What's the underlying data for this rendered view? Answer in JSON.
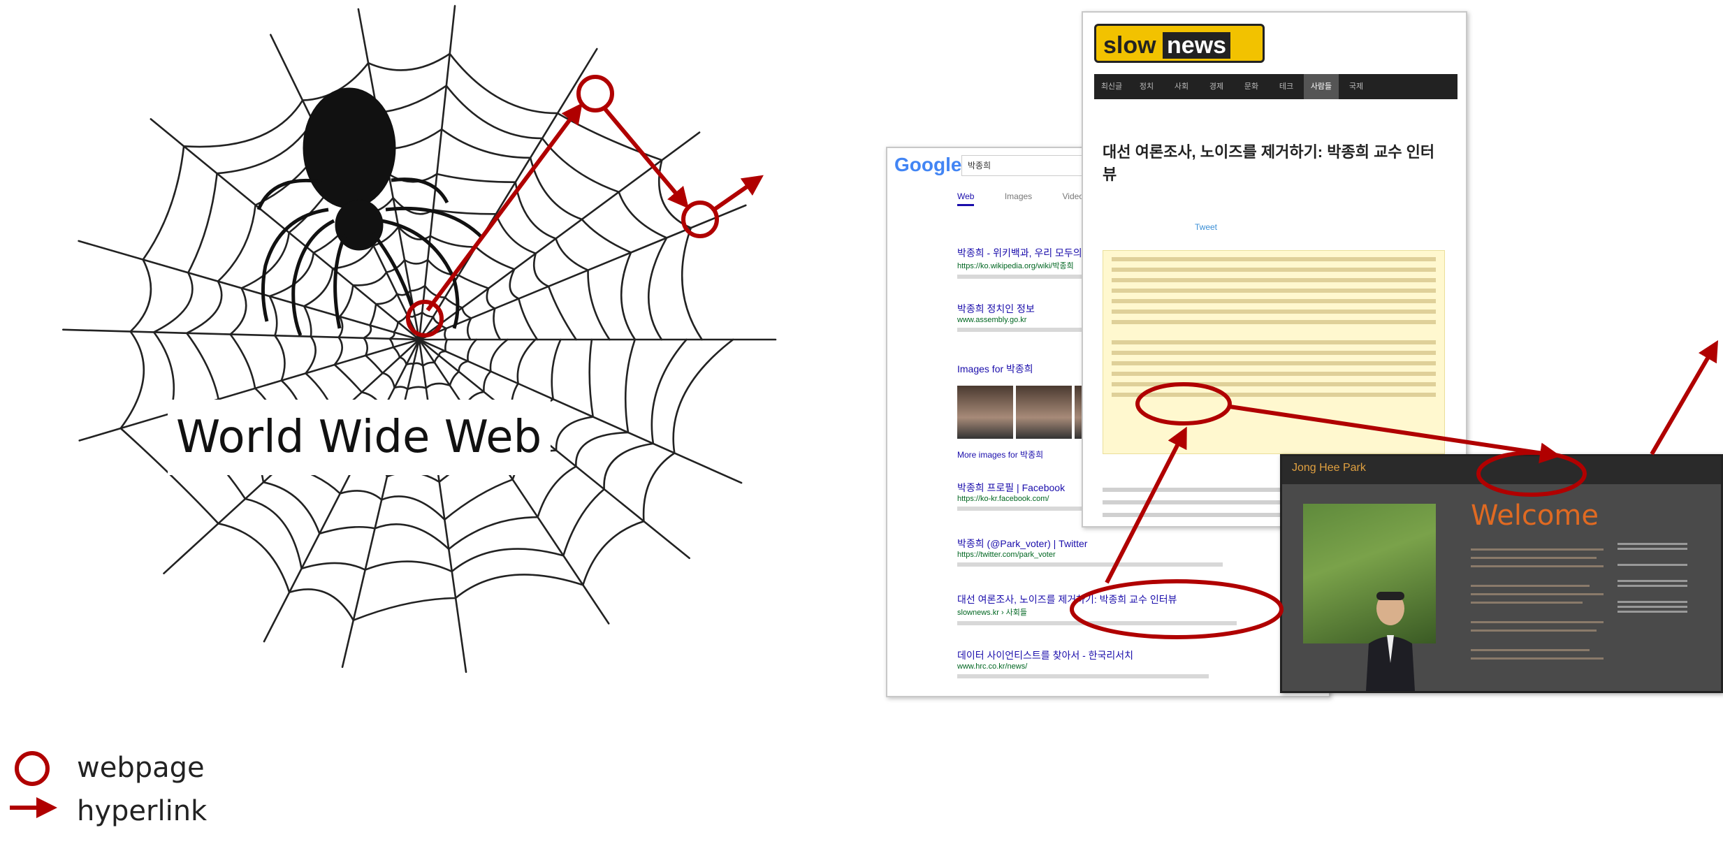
{
  "web_label": "World Wide Web",
  "legend": {
    "webpage": "webpage",
    "hyperlink": "hyperlink"
  },
  "colors": {
    "accent": "#b00000",
    "web": "#222222",
    "spider": "#111111"
  },
  "google_page": {
    "logo": "Google",
    "query": "박종희",
    "tabs": [
      "Web",
      "Images",
      "Videos"
    ],
    "images_heading": "Images for 박종희",
    "more_images": "More images for 박종희",
    "results": [
      {
        "title": "박종희 - 위키백과, 우리 모두의 백과사전",
        "url": "https://ko.wikipedia.org/wiki/박종희"
      },
      {
        "title": "박종희 정치인 정보",
        "url": "www.assembly.go.kr"
      },
      {
        "title": "박종희 프로필 | Facebook",
        "url": "https://ko-kr.facebook.com/"
      },
      {
        "title": "박종희 (@Park_voter) | Twitter",
        "url": "https://twitter.com/park_voter"
      },
      {
        "title": "대선 여론조사, 노이즈를 제거하기: 박종희 교수 인터뷰",
        "url": "slownews.kr › 사회들"
      },
      {
        "title": "데이터 사이언티스트를 찾아서 - 한국리서치",
        "url": "www.hrc.co.kr/news/"
      }
    ]
  },
  "slow_news": {
    "logo_a": "slow",
    "logo_b": "news",
    "nav": [
      "최신글",
      "정치",
      "사회",
      "경제",
      "문화",
      "테크",
      "사람들",
      "국제"
    ],
    "title": "대선 여론조사, 노이즈를 제거하기: 박종희 교수 인터뷰",
    "tweet": "Tweet"
  },
  "welcome_page": {
    "name": "Jong Hee Park",
    "heading": "Welcome"
  }
}
